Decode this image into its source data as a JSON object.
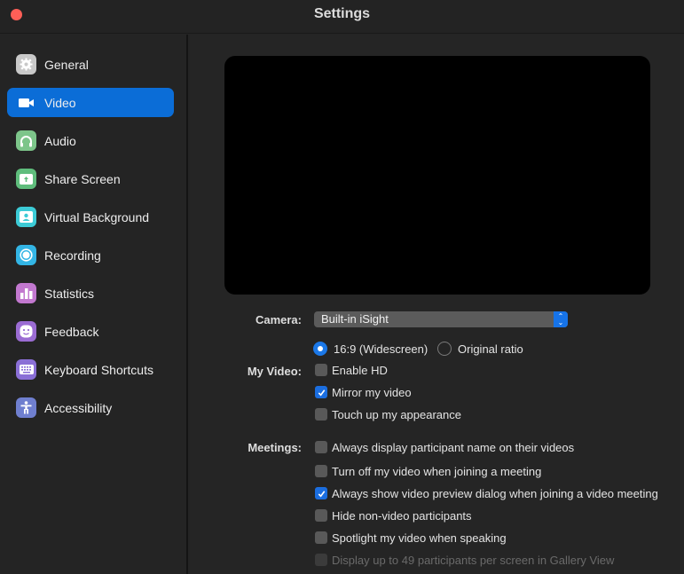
{
  "window": {
    "title": "Settings"
  },
  "sidebar": {
    "items": [
      {
        "label": "General",
        "icon": "gear-icon",
        "color": "#c9c9c9",
        "active": false
      },
      {
        "label": "Video",
        "icon": "video-camera-icon",
        "color": "#0b6dd7",
        "active": true
      },
      {
        "label": "Audio",
        "icon": "headphones-icon",
        "color": "#7dc58a",
        "active": false
      },
      {
        "label": "Share Screen",
        "icon": "share-screen-icon",
        "color": "#5fbd7c",
        "active": false
      },
      {
        "label": "Virtual Background",
        "icon": "virtual-background-icon",
        "color": "#3ccbd6",
        "active": false
      },
      {
        "label": "Recording",
        "icon": "recording-icon",
        "color": "#33b5e5",
        "active": false
      },
      {
        "label": "Statistics",
        "icon": "statistics-icon",
        "color": "#c278cf",
        "active": false
      },
      {
        "label": "Feedback",
        "icon": "feedback-icon",
        "color": "#9b6cd3",
        "active": false
      },
      {
        "label": "Keyboard Shortcuts",
        "icon": "keyboard-icon",
        "color": "#8a6fd6",
        "active": false
      },
      {
        "label": "Accessibility",
        "icon": "accessibility-icon",
        "color": "#6f7fcf",
        "active": false
      }
    ]
  },
  "camera": {
    "label": "Camera:",
    "selected": "Built-in iSight"
  },
  "my_video": {
    "label": "My Video:",
    "aspect": [
      {
        "label": "16:9 (Widescreen)",
        "selected": true
      },
      {
        "label": "Original ratio",
        "selected": false
      }
    ],
    "options": [
      {
        "label": "Enable HD",
        "checked": false
      },
      {
        "label": "Mirror my video",
        "checked": true
      },
      {
        "label": "Touch up my appearance",
        "checked": false
      }
    ]
  },
  "meetings": {
    "label": "Meetings:",
    "options": [
      {
        "label": "Always display participant name on their videos",
        "checked": false,
        "disabled": false
      },
      {
        "label": "Turn off my video when joining a meeting",
        "checked": false,
        "disabled": false
      },
      {
        "label": "Always show video preview dialog when joining a video meeting",
        "checked": true,
        "disabled": false
      },
      {
        "label": "Hide non-video participants",
        "checked": false,
        "disabled": false
      },
      {
        "label": "Spotlight my video when speaking",
        "checked": false,
        "disabled": false
      },
      {
        "label": "Display up to 49 participants per screen in Gallery View",
        "checked": false,
        "disabled": true
      }
    ]
  }
}
